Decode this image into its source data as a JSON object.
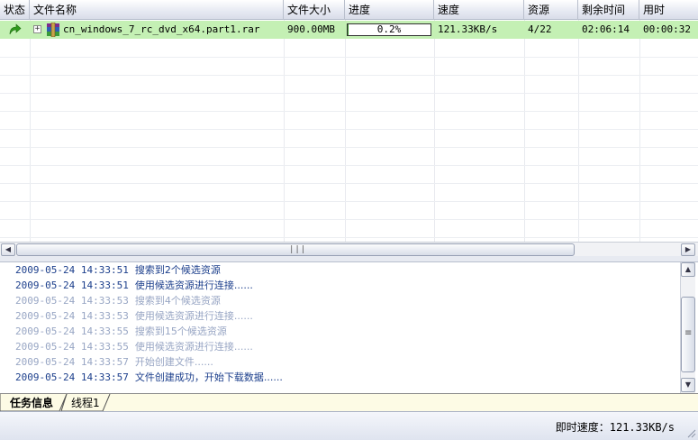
{
  "columns": {
    "status": "状态",
    "filename": "文件名称",
    "filesize": "文件大小",
    "progress": "进度",
    "speed": "速度",
    "sources": "资源",
    "remaining": "剩余时间",
    "elapsed": "用时"
  },
  "task": {
    "status_icon": "green-refresh-arrow-icon",
    "file_icon": "winrar-archive-icon",
    "filename": "cn_windows_7_rc_dvd_x64.part1.rar",
    "filesize": "900.00MB",
    "progress_label": "0.2%",
    "progress_fraction": 0.002,
    "speed": "121.33KB/s",
    "sources": "4/22",
    "remaining": "02:06:14",
    "elapsed": "00:00:32"
  },
  "log": [
    {
      "time": "2009-05-24 14:33:51",
      "message": "搜索到2个候选资源",
      "state": "active"
    },
    {
      "time": "2009-05-24 14:33:51",
      "message": "使用候选资源进行连接......",
      "state": "active"
    },
    {
      "time": "2009-05-24 14:33:53",
      "message": "搜索到4个候选资源",
      "state": "faded"
    },
    {
      "time": "2009-05-24 14:33:53",
      "message": "使用候选资源进行连接......",
      "state": "faded"
    },
    {
      "time": "2009-05-24 14:33:55",
      "message": "搜索到15个候选资源",
      "state": "faded"
    },
    {
      "time": "2009-05-24 14:33:55",
      "message": "使用候选资源进行连接......",
      "state": "faded"
    },
    {
      "time": "2009-05-24 14:33:57",
      "message": "开始创建文件......",
      "state": "faded"
    },
    {
      "time": "2009-05-24 14:33:57",
      "message": "文件创建成功，开始下载数据......",
      "state": "active"
    }
  ],
  "tabs": {
    "task_info": "任务信息",
    "thread1": "线程1"
  },
  "statusbar": {
    "speed_label": "即时速度：",
    "speed_value": "121.33KB/s"
  },
  "colors": {
    "selected_row": "#c4f0b4",
    "progress_fill": "#3c9a2e",
    "log_active": "#1c3f8c",
    "log_faded": "#98a6c4",
    "tab_strip": "#fdfbe5"
  }
}
